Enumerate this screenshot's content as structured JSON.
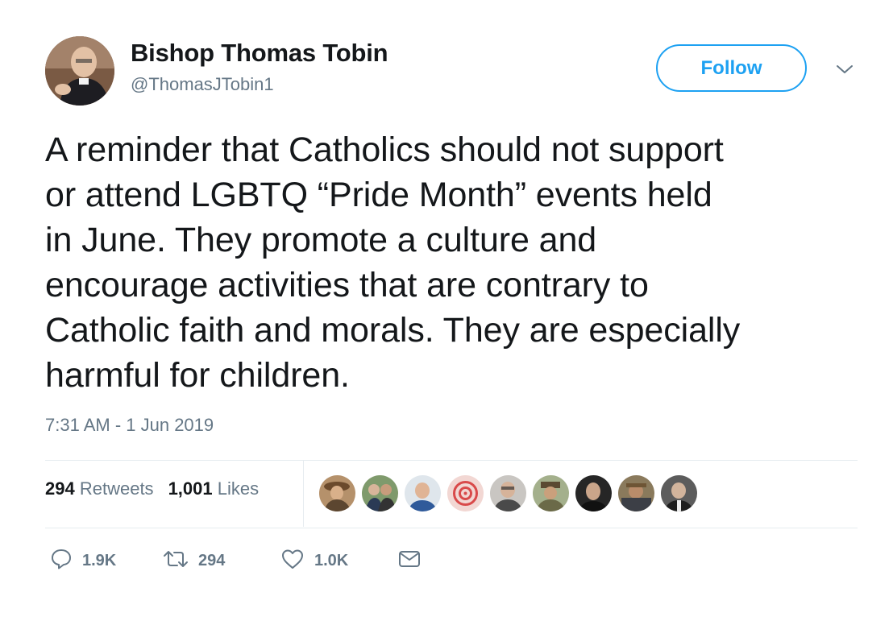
{
  "author": {
    "name": "Bishop Thomas Tobin",
    "handle": "@ThomasJTobin1"
  },
  "follow_label": "Follow",
  "tweet": {
    "text": "A reminder that Catholics should not support\nor attend LGBTQ “Pride Month” events held\nin June. They promote a culture and\nencourage activities that are contrary to\nCatholic faith and morals. They are especially\nharmful for children.",
    "timestamp": "7:31 AM - 1 Jun 2019"
  },
  "stats": {
    "retweets_count": "294",
    "retweets_label": "Retweets",
    "likes_count": "1,001",
    "likes_label": "Likes"
  },
  "actions": {
    "replies": "1.9K",
    "retweets": "294",
    "likes": "1.0K"
  },
  "colors": {
    "accent": "#1da1f2",
    "text": "#14171a",
    "muted": "#657786",
    "divider": "#e6ecf0"
  },
  "icons": {
    "reply": "reply-icon",
    "retweet": "retweet-icon",
    "like": "heart-icon",
    "dm": "envelope-icon",
    "caret": "chevron-down-icon"
  }
}
